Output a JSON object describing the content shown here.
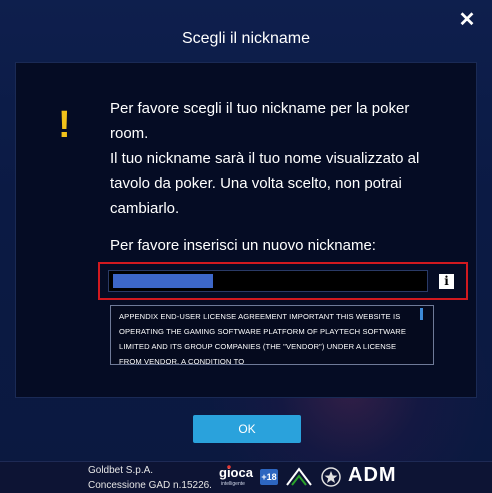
{
  "dialog": {
    "title": "Scegli il nickname",
    "close_symbol": "✕",
    "warning_symbol": "!",
    "message_line_1": "Per favore scegli il tuo nickname per la poker room.",
    "message_line_2": "Il tuo nickname sarà il tuo nome visualizzato al tavolo da poker. Una volta scelto, non potrai cambiarlo.",
    "prompt": "Per favore inserisci un nuovo nickname:",
    "nickname_value": "",
    "info_symbol": "i",
    "license_text": "APPENDIX END-USER LICENSE AGREEMENT IMPORTANT THIS WEBSITE IS OPERATING THE GAMING SOFTWARE PLATFORM OF PLAYTECH SOFTWARE LIMITED AND ITS GROUP COMPANIES (THE \"VENDOR\") UNDER A LICENSE FROM VENDOR. A CONDITION TO",
    "ok_label": "OK"
  },
  "footer": {
    "company_name": "Goldbet S.p.A.",
    "concession": "Concessione GAD n.15226.",
    "logo_gioca_text": "gioca",
    "logo_gioca_sub": "intelligente",
    "logo_18_text": "+18",
    "logo_adm_text": "ADM"
  },
  "colors": {
    "accent_button": "#2aa2dc",
    "warning": "#f2c21a",
    "highlight_border": "#d1191f",
    "background": "#0b1a44"
  }
}
